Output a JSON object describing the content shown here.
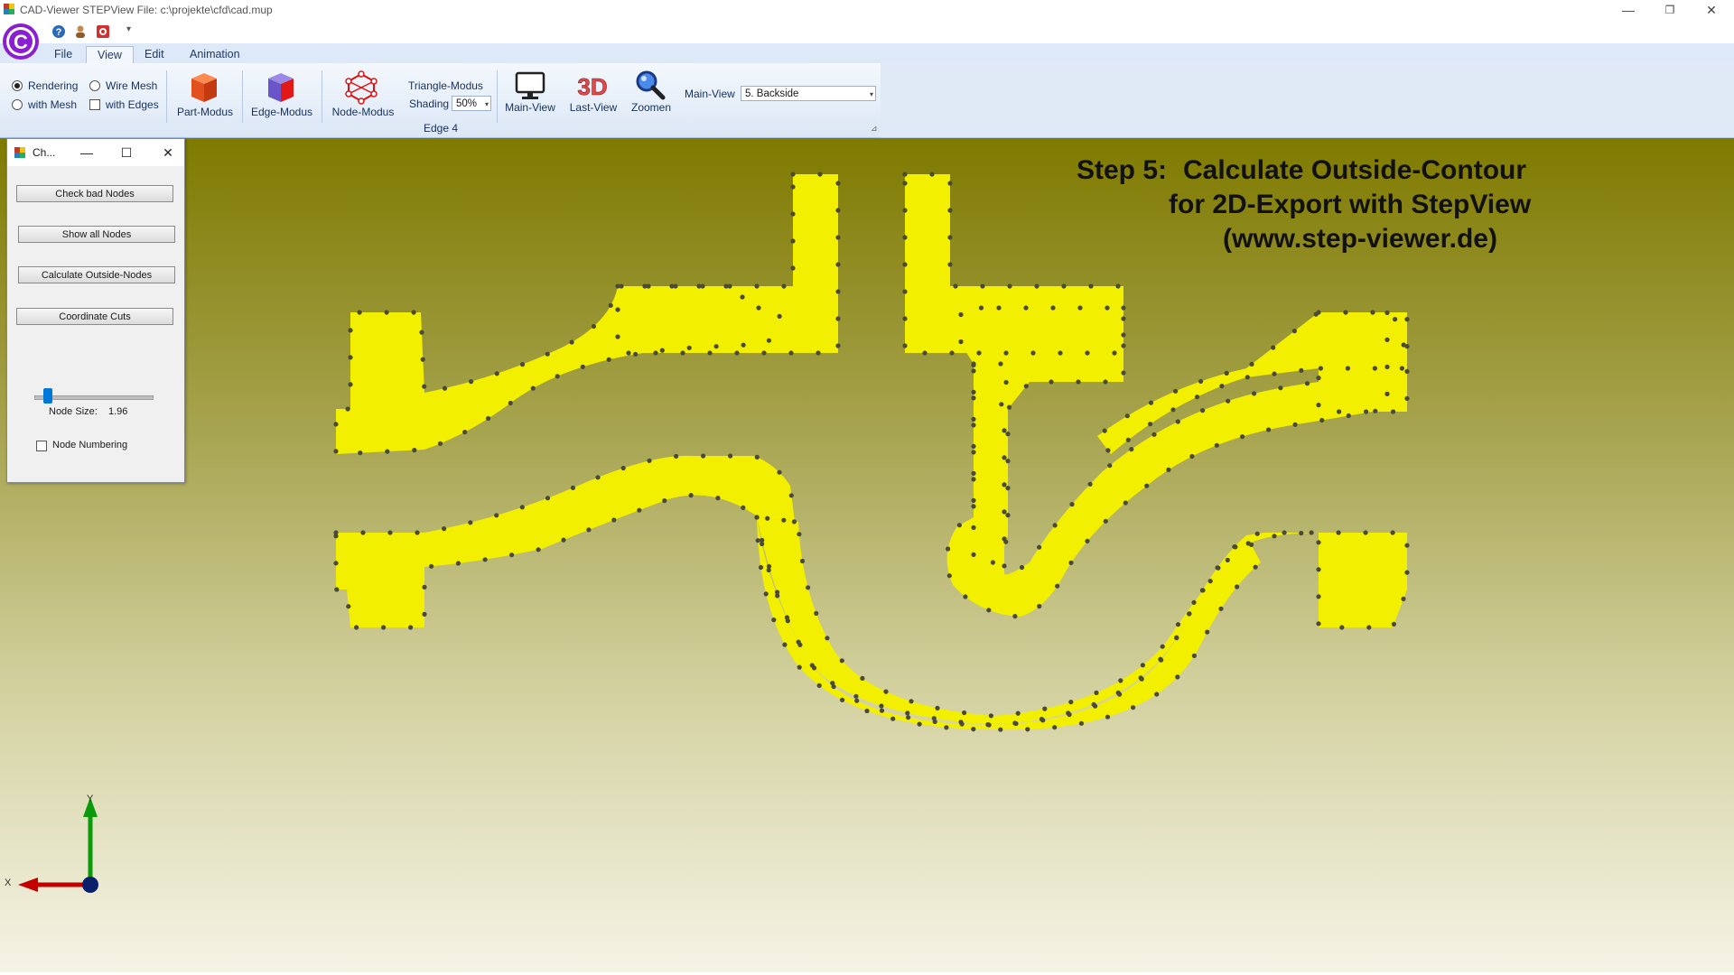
{
  "window": {
    "title": "CAD-Viewer STEPView  File: c:\\projekte\\cfd\\cad.mup",
    "minimize_glyph": "—",
    "restore_glyph": "❐",
    "close_glyph": "✕"
  },
  "quick_access": {
    "logo_letter": "C",
    "items": [
      "help-icon",
      "user-icon",
      "record-icon"
    ],
    "dropdown_glyph": "▾"
  },
  "tabs": [
    {
      "label": "File",
      "active": false
    },
    {
      "label": "View",
      "active": true
    },
    {
      "label": "Edit",
      "active": false
    },
    {
      "label": "Animation",
      "active": false
    }
  ],
  "ribbon": {
    "render_options": {
      "rendering": "Rendering",
      "with_mesh": "with Mesh",
      "wire_mesh": "Wire Mesh",
      "with_edges": "with Edges"
    },
    "part_modus": "Part-Modus",
    "edge_modus": "Edge-Modus",
    "node_modus": "Node-Modus",
    "triangle_modus": "Triangle-Modus",
    "shading_label": "Shading",
    "shading_value": "50%",
    "group_label": "Edge 4",
    "main_view_btn": "Main-View",
    "last_view_btn": "Last-View",
    "last_view_icon_text": "3D",
    "zoomen_btn": "Zoomen",
    "main_view_label": "Main-View",
    "main_view_value": "5.  Backside",
    "expand_glyph": "⊿"
  },
  "panel": {
    "title": "Ch...",
    "minimize_glyph": "—",
    "maximize_glyph": "☐",
    "close_glyph": "✕",
    "check_bad_nodes": "Check bad Nodes",
    "show_all_nodes": "Show all Nodes",
    "calculate_outside_nodes": "Calculate Outside-Nodes",
    "coordinate_cuts": "Coordinate Cuts",
    "node_size_label": "Node Size:",
    "node_size_value": "1.96",
    "node_size_fraction": 0.08,
    "node_numbering": "Node Numbering"
  },
  "viewport": {
    "overlay_line1_step": "Step 5:",
    "overlay_line1_rest": "Calculate Outside-Contour",
    "overlay_line2": "for 2D-Export with StepView",
    "overlay_line3": "(www.step-viewer.de)",
    "axis_y": "Y",
    "axis_x": "X",
    "part_color": "#f2ef00",
    "node_color": "#4a4a3a"
  }
}
